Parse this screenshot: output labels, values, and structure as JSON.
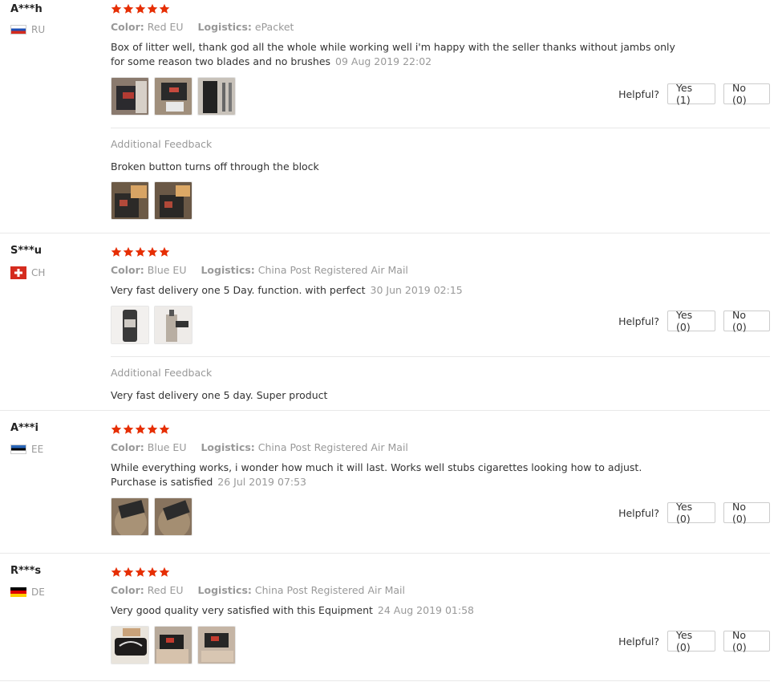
{
  "labels": {
    "color": "Color:",
    "logistics": "Logistics:",
    "helpful": "Helpful?",
    "additional_feedback": "Additional Feedback"
  },
  "colors": {
    "star": "#e62e04"
  },
  "reviews": [
    {
      "name": "A***h",
      "country": "RU",
      "rating": 5,
      "color": "Red EU",
      "logistics": "ePacket",
      "text": "Box of litter well, thank god all the whole while working well i'm happy with the seller thanks without jambs only for some reason two blades and no brushes",
      "date": "09 Aug 2019 22:02",
      "yes": "Yes (1)",
      "no": "No (0)",
      "additional": {
        "text": "Broken button turns off through the block"
      }
    },
    {
      "name": "S***u",
      "country": "CH",
      "rating": 5,
      "color": "Blue EU",
      "logistics": "China Post Registered Air Mail",
      "text": "Very fast delivery one 5 Day. function. with perfect",
      "date": "30 Jun 2019 02:15",
      "yes": "Yes (0)",
      "no": "No (0)",
      "additional": {
        "text": "Very fast delivery one 5 day. Super product"
      }
    },
    {
      "name": "A***i",
      "country": "EE",
      "rating": 5,
      "color": "Blue EU",
      "logistics": "China Post Registered Air Mail",
      "text": "While everything works, i wonder how much it will last. Works well stubs cigarettes looking how to adjust. Purchase is satisfied",
      "date": "26 Jul 2019 07:53",
      "yes": "Yes (0)",
      "no": "No (0)"
    },
    {
      "name": "R***s",
      "country": "DE",
      "rating": 5,
      "color": "Red EU",
      "logistics": "China Post Registered Air Mail",
      "text": "Very good quality very satisfied with this Equipment",
      "date": "24 Aug 2019 01:58",
      "yes": "Yes (0)",
      "no": "No (0)"
    }
  ]
}
